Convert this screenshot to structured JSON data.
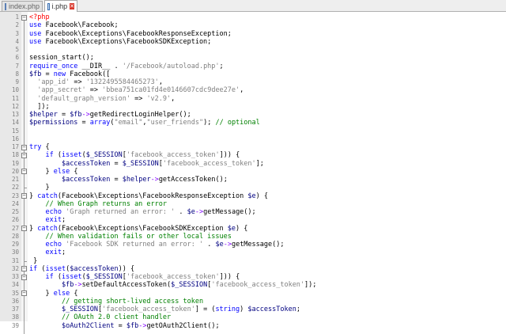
{
  "tabs": [
    {
      "label": "index.php",
      "active": false
    },
    {
      "label": "i.php",
      "active": true
    }
  ],
  "close_icon": "close-icon",
  "lines": [
    {
      "n": "1",
      "code": [
        [
          "php",
          "<?php"
        ]
      ]
    },
    {
      "n": "2",
      "code": [
        [
          "kw",
          "use"
        ],
        [
          "n",
          " Facebook\\Facebook;"
        ]
      ]
    },
    {
      "n": "3",
      "code": [
        [
          "kw",
          "use"
        ],
        [
          "n",
          " Facebook\\Exceptions\\FacebookResponseException;"
        ]
      ]
    },
    {
      "n": "4",
      "code": [
        [
          "kw",
          "use"
        ],
        [
          "n",
          " Facebook\\Exceptions\\FacebookSDKException;"
        ]
      ]
    },
    {
      "n": "5",
      "code": []
    },
    {
      "n": "6",
      "code": [
        [
          "n",
          "session_start();"
        ]
      ]
    },
    {
      "n": "7",
      "code": [
        [
          "kw",
          "require_once"
        ],
        [
          "n",
          " __DIR__ . "
        ],
        [
          "str",
          "'/Facebook/autoload.php'"
        ],
        [
          "n",
          ";"
        ]
      ]
    },
    {
      "n": "8",
      "code": [
        [
          "var",
          "$fb"
        ],
        [
          "n",
          " = "
        ],
        [
          "kw",
          "new"
        ],
        [
          "n",
          " Facebook(["
        ]
      ]
    },
    {
      "n": "9",
      "code": [
        [
          "n",
          "  "
        ],
        [
          "str",
          "'app_id'"
        ],
        [
          "n",
          " => "
        ],
        [
          "str",
          "'1322495584465273'"
        ],
        [
          "n",
          ","
        ]
      ]
    },
    {
      "n": "10",
      "code": [
        [
          "n",
          "  "
        ],
        [
          "str",
          "'app_secret'"
        ],
        [
          "n",
          " => "
        ],
        [
          "str",
          "'bbea751ca01fd4e0146607cdc9dee27e'"
        ],
        [
          "n",
          ","
        ]
      ]
    },
    {
      "n": "11",
      "code": [
        [
          "n",
          "  "
        ],
        [
          "str",
          "'default_graph_version'"
        ],
        [
          "n",
          " => "
        ],
        [
          "str",
          "'v2.9'"
        ],
        [
          "n",
          ","
        ]
      ]
    },
    {
      "n": "12",
      "code": [
        [
          "n",
          "  ]);"
        ]
      ]
    },
    {
      "n": "13",
      "code": [
        [
          "var",
          "$helper"
        ],
        [
          "n",
          " = "
        ],
        [
          "var",
          "$fb"
        ],
        [
          "op",
          "->"
        ],
        [
          "n",
          "getRedirectLoginHelper();"
        ]
      ]
    },
    {
      "n": "14",
      "code": [
        [
          "var",
          "$permissions"
        ],
        [
          "n",
          " = "
        ],
        [
          "kw",
          "array"
        ],
        [
          "n",
          "("
        ],
        [
          "str",
          "\"email\""
        ],
        [
          "n",
          ","
        ],
        [
          "str",
          "\"user_friends\""
        ],
        [
          "n",
          "); "
        ],
        [
          "com",
          "// optional"
        ]
      ]
    },
    {
      "n": "15",
      "code": []
    },
    {
      "n": "16",
      "code": []
    },
    {
      "n": "17",
      "code": [
        [
          "kw",
          "try"
        ],
        [
          "n",
          " {"
        ]
      ]
    },
    {
      "n": "18",
      "code": [
        [
          "n",
          "    "
        ],
        [
          "kw",
          "if"
        ],
        [
          "n",
          " ("
        ],
        [
          "kw",
          "isset"
        ],
        [
          "n",
          "("
        ],
        [
          "var",
          "$_SESSION"
        ],
        [
          "n",
          "["
        ],
        [
          "str",
          "'facebook_access_token'"
        ],
        [
          "n",
          "])) {"
        ]
      ]
    },
    {
      "n": "19",
      "code": [
        [
          "n",
          "        "
        ],
        [
          "var",
          "$accessToken"
        ],
        [
          "n",
          " = "
        ],
        [
          "var",
          "$_SESSION"
        ],
        [
          "n",
          "["
        ],
        [
          "str",
          "'facebook_access_token'"
        ],
        [
          "n",
          "];"
        ]
      ]
    },
    {
      "n": "20",
      "code": [
        [
          "n",
          "    } "
        ],
        [
          "kw",
          "else"
        ],
        [
          "n",
          " {"
        ]
      ]
    },
    {
      "n": "21",
      "code": [
        [
          "n",
          "        "
        ],
        [
          "var",
          "$accessToken"
        ],
        [
          "n",
          " = "
        ],
        [
          "var",
          "$helper"
        ],
        [
          "op",
          "->"
        ],
        [
          "n",
          "getAccessToken();"
        ]
      ]
    },
    {
      "n": "22",
      "code": [
        [
          "n",
          "    }"
        ]
      ]
    },
    {
      "n": "23",
      "code": [
        [
          "n",
          "} "
        ],
        [
          "kw",
          "catch"
        ],
        [
          "n",
          "(Facebook\\Exceptions\\FacebookResponseException "
        ],
        [
          "var",
          "$e"
        ],
        [
          "n",
          ") {"
        ]
      ]
    },
    {
      "n": "24",
      "code": [
        [
          "n",
          "    "
        ],
        [
          "com",
          "// When Graph returns an error"
        ]
      ]
    },
    {
      "n": "25",
      "code": [
        [
          "n",
          "    "
        ],
        [
          "kw",
          "echo"
        ],
        [
          "n",
          " "
        ],
        [
          "str",
          "'Graph returned an error: '"
        ],
        [
          "n",
          " . "
        ],
        [
          "var",
          "$e"
        ],
        [
          "op",
          "->"
        ],
        [
          "n",
          "getMessage();"
        ]
      ]
    },
    {
      "n": "26",
      "code": [
        [
          "n",
          "    "
        ],
        [
          "kw",
          "exit"
        ],
        [
          "n",
          ";"
        ]
      ]
    },
    {
      "n": "27",
      "code": [
        [
          "n",
          "} "
        ],
        [
          "kw",
          "catch"
        ],
        [
          "n",
          "(Facebook\\Exceptions\\FacebookSDKException "
        ],
        [
          "var",
          "$e"
        ],
        [
          "n",
          ") {"
        ]
      ]
    },
    {
      "n": "28",
      "code": [
        [
          "n",
          "    "
        ],
        [
          "com",
          "// When validation fails or other local issues"
        ]
      ]
    },
    {
      "n": "29",
      "code": [
        [
          "n",
          "    "
        ],
        [
          "kw",
          "echo"
        ],
        [
          "n",
          " "
        ],
        [
          "str",
          "'Facebook SDK returned an error: '"
        ],
        [
          "n",
          " . "
        ],
        [
          "var",
          "$e"
        ],
        [
          "op",
          "->"
        ],
        [
          "n",
          "getMessage();"
        ]
      ]
    },
    {
      "n": "30",
      "code": [
        [
          "n",
          "    "
        ],
        [
          "kw",
          "exit"
        ],
        [
          "n",
          ";"
        ]
      ]
    },
    {
      "n": "31",
      "code": [
        [
          "n",
          " }"
        ]
      ]
    },
    {
      "n": "32",
      "code": [
        [
          "kw",
          "if"
        ],
        [
          "n",
          " ("
        ],
        [
          "kw",
          "isset"
        ],
        [
          "n",
          "("
        ],
        [
          "var",
          "$accessToken"
        ],
        [
          "n",
          ")) {"
        ]
      ]
    },
    {
      "n": "33",
      "code": [
        [
          "n",
          "    "
        ],
        [
          "kw",
          "if"
        ],
        [
          "n",
          " ("
        ],
        [
          "kw",
          "isset"
        ],
        [
          "n",
          "("
        ],
        [
          "var",
          "$_SESSION"
        ],
        [
          "n",
          "["
        ],
        [
          "str",
          "'facebook_access_token'"
        ],
        [
          "n",
          "])) {"
        ]
      ]
    },
    {
      "n": "34",
      "code": [
        [
          "n",
          "        "
        ],
        [
          "var",
          "$fb"
        ],
        [
          "op",
          "->"
        ],
        [
          "n",
          "setDefaultAccessToken("
        ],
        [
          "var",
          "$_SESSION"
        ],
        [
          "n",
          "["
        ],
        [
          "str",
          "'facebook_access_token'"
        ],
        [
          "n",
          "]);"
        ]
      ]
    },
    {
      "n": "35",
      "code": [
        [
          "n",
          "    } "
        ],
        [
          "kw",
          "else"
        ],
        [
          "n",
          " {"
        ]
      ]
    },
    {
      "n": "36",
      "code": [
        [
          "n",
          "        "
        ],
        [
          "com",
          "// getting short-lived access token"
        ]
      ]
    },
    {
      "n": "37",
      "code": [
        [
          "n",
          "        "
        ],
        [
          "var",
          "$_SESSION"
        ],
        [
          "n",
          "["
        ],
        [
          "str",
          "'facebook_access_token'"
        ],
        [
          "n",
          "] = ("
        ],
        [
          "kw",
          "string"
        ],
        [
          "n",
          ") "
        ],
        [
          "var",
          "$accessToken"
        ],
        [
          "n",
          ";"
        ]
      ]
    },
    {
      "n": "38",
      "code": [
        [
          "n",
          "        "
        ],
        [
          "com",
          "// OAuth 2.0 client handler"
        ]
      ]
    },
    {
      "n": "39",
      "code": [
        [
          "n",
          "        "
        ],
        [
          "var",
          "$oAuth2Client"
        ],
        [
          "n",
          " = "
        ],
        [
          "var",
          "$fb"
        ],
        [
          "op",
          "->"
        ],
        [
          "n",
          "getOAuth2Client();"
        ]
      ]
    }
  ]
}
